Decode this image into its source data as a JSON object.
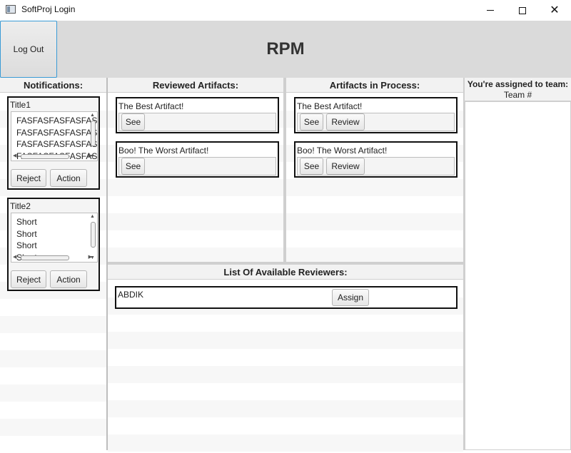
{
  "window": {
    "title": "SoftProj Login"
  },
  "header": {
    "logout_label": "Log Out",
    "title": "RPM"
  },
  "notifications": {
    "heading": "Notifications:",
    "items": [
      {
        "title": "Title1",
        "lines": [
          "FASFASFASFASFAS",
          "FASFASFASFASFAS",
          "FASFASFASFASFAS",
          "FASFASFASFASFAS"
        ],
        "reject_label": "Reject",
        "action_label": "Action"
      },
      {
        "title": "Title2",
        "lines": [
          "Short",
          "Short",
          "Short",
          "Short"
        ],
        "reject_label": "Reject",
        "action_label": "Action"
      }
    ]
  },
  "reviewed": {
    "heading": "Reviewed Artifacts:",
    "items": [
      {
        "title": "The Best Artifact!",
        "see_label": "See"
      },
      {
        "title": "Boo! The Worst Artifact!",
        "see_label": "See"
      }
    ]
  },
  "in_process": {
    "heading": "Artifacts in Process:",
    "items": [
      {
        "title": "The Best Artifact!",
        "see_label": "See",
        "review_label": "Review"
      },
      {
        "title": "Boo! The Worst Artifact!",
        "see_label": "See",
        "review_label": "Review"
      }
    ]
  },
  "reviewers": {
    "heading": "List Of Available Reviewers:",
    "items": [
      {
        "name": "ABDIK",
        "assign_label": "Assign"
      }
    ]
  },
  "team": {
    "heading": "You're assigned to team:",
    "subheading": "Team #"
  }
}
